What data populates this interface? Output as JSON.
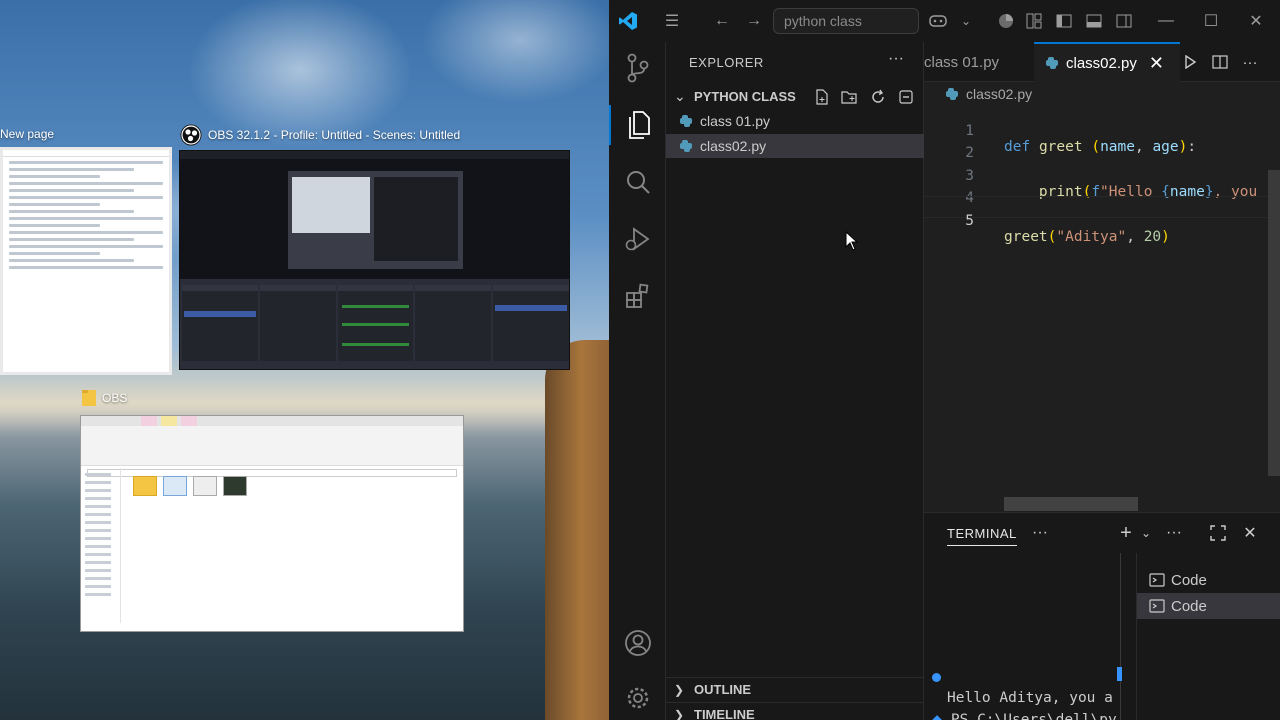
{
  "desktop": {
    "windows": [
      {
        "title": "New page",
        "icon": "browser-page-icon"
      },
      {
        "title": "OBS 32.1.2 - Profile: Untitled - Scenes: Untitled",
        "icon": "obs-logo-icon"
      },
      {
        "title": "OBS",
        "icon": "folder-icon"
      }
    ]
  },
  "vscode": {
    "titlebar": {
      "search_placeholder": "python class"
    },
    "sidebar": {
      "title": "EXPLORER",
      "more": "···",
      "folder": "PYTHON CLASS",
      "files": [
        "class 01.py",
        "class02.py"
      ],
      "selected_file": "class02.py",
      "sections": [
        "OUTLINE",
        "TIMELINE"
      ]
    },
    "editor": {
      "tabs": [
        {
          "label": "class 01.py",
          "active": false
        },
        {
          "label": "class02.py",
          "active": true
        }
      ],
      "breadcrumb": "class02.py",
      "line_numbers": [
        "1",
        "2",
        "3",
        "4",
        "5"
      ],
      "current_line": 5
    },
    "terminal": {
      "title": "TERMINAL",
      "more": "···",
      "output_line1": "Hello Aditya, you a",
      "output_line2": "PS C:\\Users\\dell\\py",
      "terminals": [
        "Code",
        "Code"
      ],
      "selected_terminal": 1
    },
    "colors": {
      "accent": "#0078d4",
      "keyword": "#569cd6",
      "function": "#dcdcaa",
      "string": "#ce9178",
      "number": "#b5cea8",
      "python_icon": "#519aba"
    }
  }
}
